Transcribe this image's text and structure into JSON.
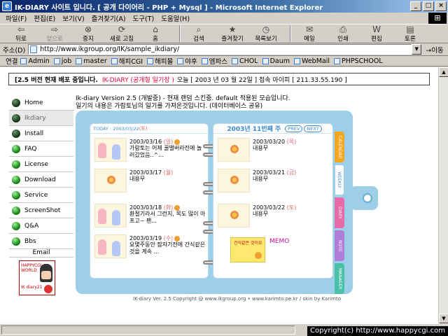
{
  "window": {
    "title": "IK-DIARY 사이트 입니다. [ 공개 다이어리 - PHP + Mysql ] - Microsoft Internet Explorer",
    "min": "_",
    "max": "□",
    "close": "×"
  },
  "menu": [
    "파일(F)",
    "편집(E)",
    "보기(V)",
    "즐겨찾기(A)",
    "도구(T)",
    "도움말(H)"
  ],
  "toolbar": {
    "back": "뒤로",
    "forward": "앞으로",
    "stop": "중지",
    "refresh": "새로 고침",
    "home": "홈",
    "search": "검색",
    "favorites": "즐겨찾기",
    "history": "목록보기",
    "mail": "메일",
    "print": "인쇄",
    "edit": "편집",
    "discuss": "토론"
  },
  "address": {
    "label": "주소(D)",
    "url": "http://www.ikgroup.org/IK/sample_ikdiary/",
    "go": "이동"
  },
  "links": {
    "label": "연결",
    "items": [
      "Admin",
      "job",
      "master",
      "해피CGI",
      "해피몰",
      "야후",
      "엠파스",
      "CHOL",
      "Daum",
      "WebMail",
      "PHPSCHOOL"
    ]
  },
  "notice": {
    "version": "[2.5 버전 현재 배포 중입니다.",
    "diary": "IK-DIARY (공개형 일기장 )",
    "info": "오늘 [ 2003 년 03 월 22일 ] 접속 아이피 [ 211.33.55.190 ]"
  },
  "nav": {
    "items": [
      "Home",
      "Ikdiary",
      "Install",
      "FAQ",
      "License",
      "Download",
      "Service",
      "ScreenShot",
      "Q&A",
      "Bbs"
    ],
    "email": "Email",
    "banner_top": "HAPPYCGI WORLD",
    "banner_bottom": "IK diary21"
  },
  "intro": {
    "line1": "Ik-diary Version 2.5 (개발중) - 현재 랜덤 스킨중. default 적용된 모습입니다.",
    "line2": "일기의 내용은 가람토님의 일기를 가져온것입니다. (데이터베이스 공유)"
  },
  "diary": {
    "today": "TODAY : 2003/03/22",
    "today_day": "(토)",
    "week": "2003년 11번째 주",
    "prev": "PREV",
    "next": "NEXT",
    "left_entries": [
      {
        "date": "2003/03/16",
        "wd": "(일)",
        "text": "가람토는 어제 꿀벌버라진에 놀러갔었음..^..."
      },
      {
        "date": "2003/03/17",
        "wd": "(월)",
        "text": "내용무"
      },
      {
        "date": "2003/03/18",
        "wd": "(화)",
        "text": "환절기라서 그런지, 목도 많이 아프고~ 팬..."
      },
      {
        "date": "2003/03/19",
        "wd": "(수)",
        "text": "요몇주동안 잠자기전에 간식같은것을 계속 ..."
      }
    ],
    "right_entries": [
      {
        "date": "2003/03/20",
        "wd": "(목)",
        "text": "내용무"
      },
      {
        "date": "2003/03/21",
        "wd": "(금)",
        "text": "내용무"
      },
      {
        "date": "2003/03/22",
        "wd": "(토)",
        "text": "내용무"
      }
    ],
    "memo_label": "MEMO",
    "memo_note": "간식같은 것이요",
    "tabs": [
      {
        "label": "CALENDAR",
        "color": "#f5a623"
      },
      {
        "label": "WEEKLY",
        "color": "#ffffff"
      },
      {
        "label": "DIARY",
        "color": "#e86aa6"
      },
      {
        "label": "NOTE",
        "color": "#b07ed8"
      },
      {
        "label": "MANAGER",
        "color": "#4ac0a8"
      }
    ]
  },
  "footer": "IK-diary Ver. 2.5 Copyright @ www.ikgroup.org • www.karimto.pe.kr / skin by Karimto",
  "copyright": "Copyright(c) http://www.happycgi.com"
}
